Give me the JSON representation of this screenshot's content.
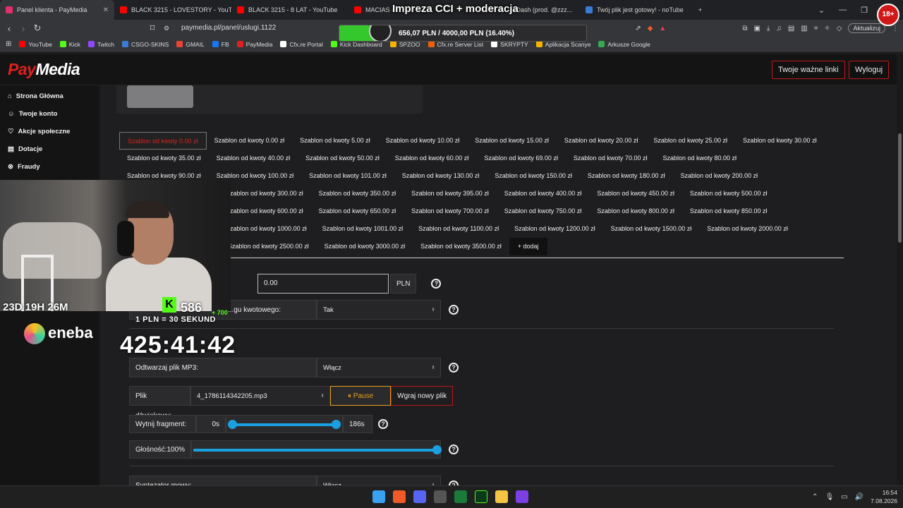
{
  "browser": {
    "tabs": [
      {
        "title": "Panel klienta - PayMedia",
        "active": true,
        "color": "#e1306c"
      },
      {
        "title": "BLACK 3215 - LOVESTORY - YouTube",
        "active": false,
        "color": "#ff0000"
      },
      {
        "title": "BLACK 3215 - 8 LAT - YouTube",
        "active": false,
        "color": "#ff0000"
      },
      {
        "title": "MACIAS - G...",
        "active": false,
        "color": "#ff0000"
      },
      {
        "title": "...Dash (prod. @zzz...",
        "active": false,
        "color": "#ff0000"
      },
      {
        "title": "Twój plik jest gotowy! - noTube",
        "active": false,
        "color": "#3a7bd5"
      }
    ],
    "url": "paymedia.pl/panel/uslugi.1122",
    "update_label": "Aktualizuj",
    "bookmarks": [
      {
        "label": "YouTube",
        "color": "#ff0000"
      },
      {
        "label": "Kick",
        "color": "#53fc18"
      },
      {
        "label": "Twitch",
        "color": "#9146ff"
      },
      {
        "label": "CSGO-SKINS",
        "color": "#3a7bd5"
      },
      {
        "label": "GMAIL",
        "color": "#ea4335"
      },
      {
        "label": "FB",
        "color": "#1877f2"
      },
      {
        "label": "PayMedia",
        "color": "#e02020"
      },
      {
        "label": "Cfx.re Portal",
        "color": "#ffffff"
      },
      {
        "label": "Kick Dashboard",
        "color": "#53fc18"
      },
      {
        "label": "SPZOO",
        "color": "#f5b400"
      },
      {
        "label": "Cfx.re Server List",
        "color": "#f06000"
      },
      {
        "label": "SKRYPTY",
        "color": "#ffffff"
      },
      {
        "label": "Aplikacja Scanye",
        "color": "#f5b400"
      },
      {
        "label": "Arkusze Google",
        "color": "#34a853"
      }
    ]
  },
  "site": {
    "logo_pay": "Pay",
    "logo_media": "Media",
    "links_button": "Twoje ważne linki",
    "logout_button": "Wyloguj",
    "sidebar": [
      {
        "label": "Strona Główna"
      },
      {
        "label": "Twoje konto"
      },
      {
        "label": "Akcje społeczne"
      },
      {
        "label": "Dotacje"
      },
      {
        "label": "Fraudy"
      }
    ]
  },
  "templates": [
    [
      "Szablon od kwoty 0.00 zł",
      "Szablon od kwoty 0.00 zł",
      "Szablon od kwoty 5.00 zł",
      "Szablon od kwoty 10.00 zł",
      "Szablon od kwoty 15.00 zł",
      "Szablon od kwoty 20.00 zł",
      "Szablon od kwoty 25.00 zł",
      "Szablon od kwoty 30.00 zł"
    ],
    [
      "Szablon od kwoty 35.00 zł",
      "Szablon od kwoty 40.00 zł",
      "Szablon od kwoty 50.00 zł",
      "Szablon od kwoty 60.00 zł",
      "Szablon od kwoty 69.00 zł",
      "Szablon od kwoty 70.00 zł",
      "Szablon od kwoty 80.00 zł"
    ],
    [
      "Szablon od kwoty 90.00 zł",
      "Szablon od kwoty 100.00 zł",
      "Szablon od kwoty 101.00 zł",
      "Szablon od kwoty 130.00 zł",
      "Szablon od kwoty 150.00 zł",
      "Szablon od kwoty 180.00 zł",
      "Szablon od kwoty 200.00 zł"
    ],
    [
      "Szablon od kwoty 300.00 zł",
      "Szablon od kwoty 350.00 zł",
      "Szablon od kwoty 395.00 zł",
      "Szablon od kwoty 400.00 zł",
      "Szablon od kwoty 450.00 zł",
      "Szablon od kwoty 500.00 zł"
    ],
    [
      "Szablon od kwoty 600.00 zł",
      "Szablon od kwoty 650.00 zł",
      "Szablon od kwoty 700.00 zł",
      "Szablon od kwoty 750.00 zł",
      "Szablon od kwoty 800.00 zł",
      "Szablon od kwoty 850.00 zł"
    ],
    [
      "Szablon od kwoty 1000.00 zł",
      "Szablon od kwoty 1001.00 zł",
      "Szablon od kwoty 1100.00 zł",
      "Szablon od kwoty 1200.00 zł",
      "Szablon od kwoty 1500.00 zł",
      "Szablon od kwoty 2000.00 zł"
    ],
    [
      "Szablon od kwoty 2500.00 zł",
      "Szablon od kwoty 3000.00 zł",
      "Szablon od kwoty 3500.00 zł"
    ]
  ],
  "add_template_label": "+ dodaj",
  "form": {
    "amount_value": "0.00",
    "amount_unit": "PLN",
    "threshold_label": "...gu kwotowego:",
    "threshold_value": "Tak",
    "mp3_label": "Odtwarzaj plik MP3:",
    "mp3_value": "Włącz",
    "file_label": "Plik dźwiękowy:",
    "file_value": "4_1786114342205.mp3",
    "pause_label": "Pause",
    "upload_label": "Wgraj nowy plik",
    "cut_label": "Wytnij fragment:",
    "cut_start": "0s",
    "cut_end": "186s",
    "volume_label": "Głośność:100%",
    "volume_fraction": 1.0,
    "synth_label": "Syntezator mowy:",
    "synth_value": "Włącz"
  },
  "overlay": {
    "impreza_title": "Impreza CCI + moderacja",
    "donation_text": "656,07 PLN / 4000,00 PLN (16.40%)",
    "donation_fraction": 0.164,
    "countdown": "23D 19H 26M",
    "kick_count": "586",
    "kick_plus": "+ 700",
    "rate_text": "1 PLN = 30 SEKUND",
    "timer": "425:41:42",
    "eneba": "eneba",
    "avatar_text": "18+"
  },
  "taskbar": {
    "time": "16:54",
    "date": "7.08.2026"
  },
  "colors": {
    "brand_red": "#e02020",
    "accent_blue": "#1aa0e0",
    "pause_amber": "#e0a020",
    "kick_green": "#53fc18"
  }
}
